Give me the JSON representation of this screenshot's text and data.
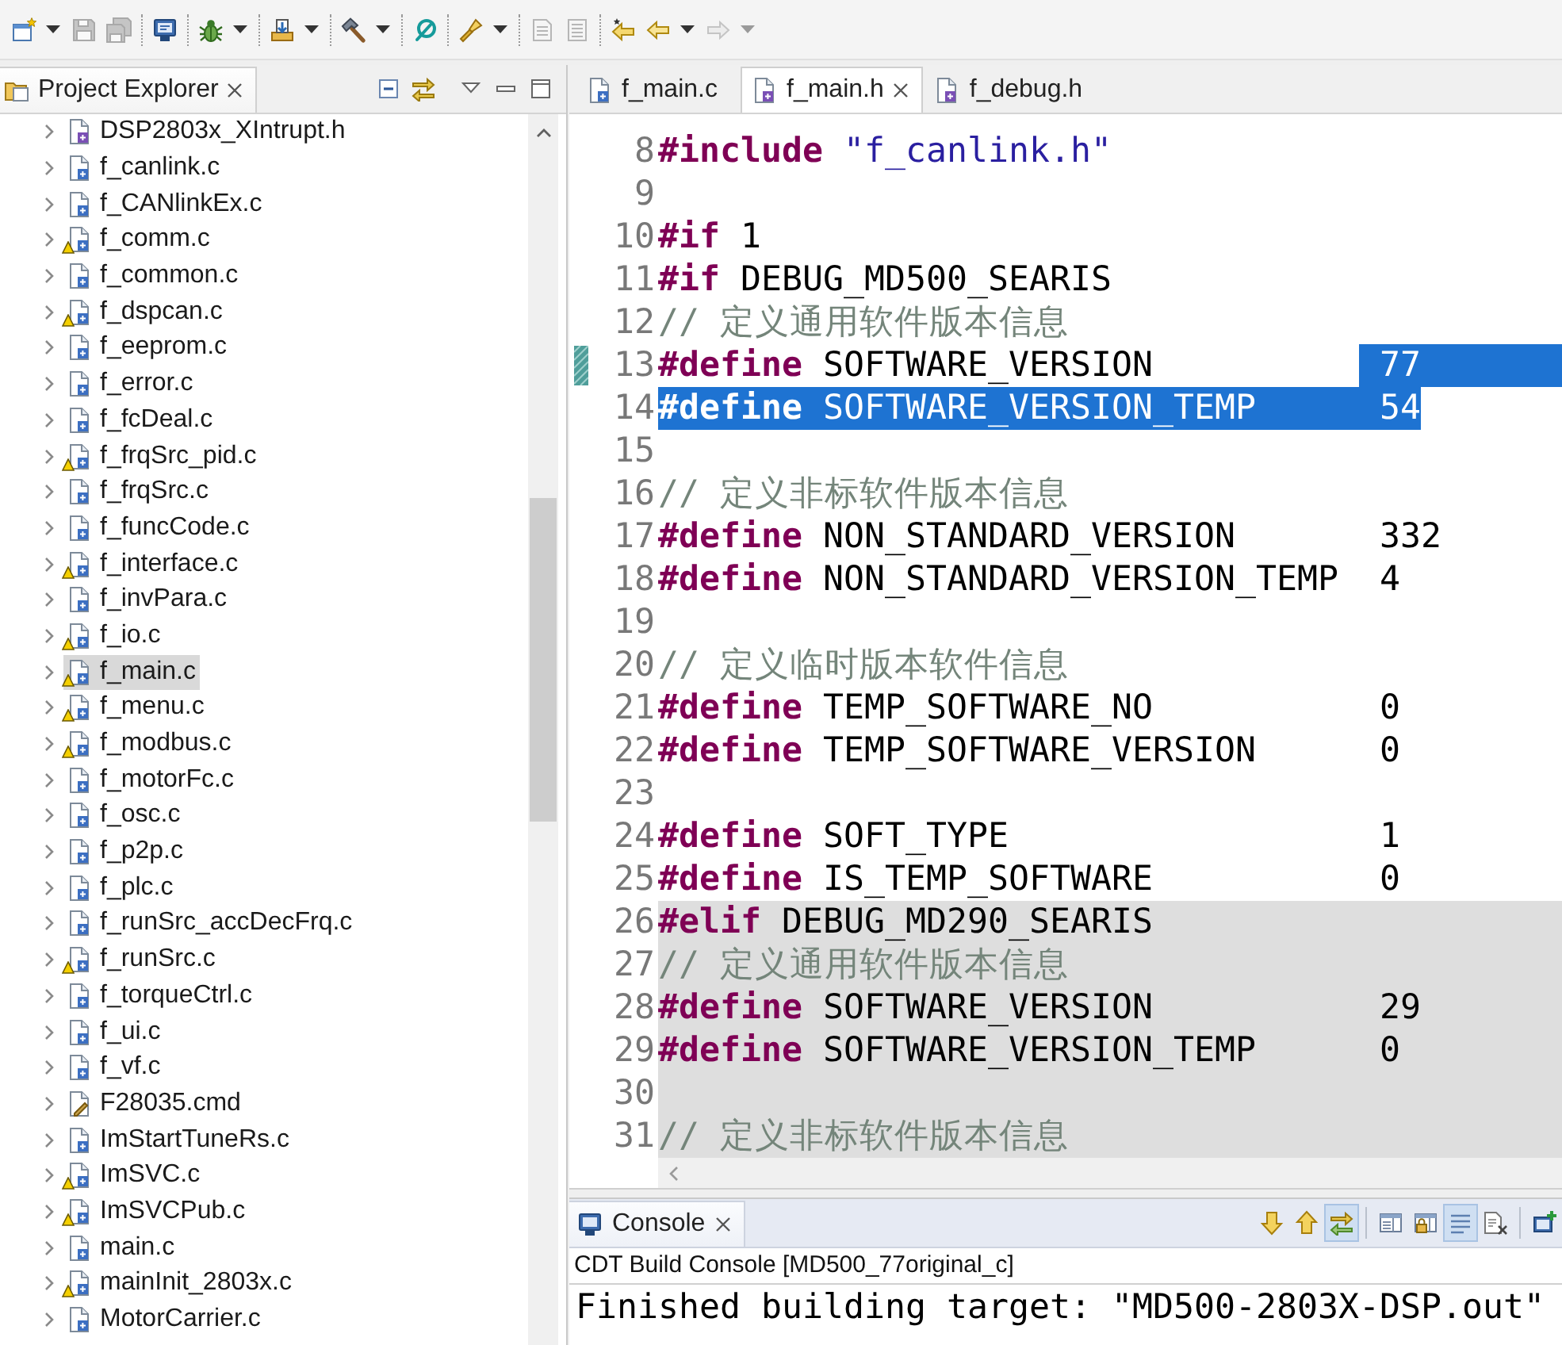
{
  "toolbar": {
    "buttons": [
      {
        "kind": "new",
        "disabled": false,
        "dropdown": true,
        "separator_after": false
      },
      {
        "kind": "save",
        "disabled": true,
        "dropdown": false,
        "separator_after": false
      },
      {
        "kind": "save_all",
        "disabled": true,
        "dropdown": false,
        "separator_after": true
      },
      {
        "kind": "terminal",
        "disabled": false,
        "dropdown": false,
        "separator_after": true
      },
      {
        "kind": "debug",
        "disabled": false,
        "dropdown": true,
        "separator_after": true
      },
      {
        "kind": "load",
        "disabled": false,
        "dropdown": true,
        "separator_after": true
      },
      {
        "kind": "build",
        "disabled": false,
        "dropdown": true,
        "separator_after": true
      },
      {
        "kind": "search",
        "disabled": false,
        "dropdown": false,
        "separator_after": true
      },
      {
        "kind": "tool",
        "disabled": false,
        "dropdown": true,
        "separator_after": true
      },
      {
        "kind": "document",
        "disabled": true,
        "dropdown": false,
        "separator_after": false
      },
      {
        "kind": "outline",
        "disabled": true,
        "dropdown": false,
        "separator_after": true
      },
      {
        "kind": "last_edit",
        "disabled": false,
        "dropdown": false,
        "separator_after": false
      },
      {
        "kind": "back",
        "disabled": false,
        "dropdown": true,
        "separator_after": false
      },
      {
        "kind": "forward",
        "disabled": true,
        "dropdown": true,
        "separator_after": false
      }
    ]
  },
  "explorer": {
    "title": "Project Explorer",
    "items": [
      {
        "label": "DSP2803x_XIntrupt.h",
        "kind": "h",
        "warning": false,
        "selected": false,
        "expanded": false
      },
      {
        "label": "f_canlink.c",
        "kind": "c",
        "warning": false,
        "selected": false,
        "expanded": false
      },
      {
        "label": "f_CANlinkEx.c",
        "kind": "c",
        "warning": false,
        "selected": false,
        "expanded": false
      },
      {
        "label": "f_comm.c",
        "kind": "c",
        "warning": true,
        "selected": false,
        "expanded": false
      },
      {
        "label": "f_common.c",
        "kind": "c",
        "warning": false,
        "selected": false,
        "expanded": false
      },
      {
        "label": "f_dspcan.c",
        "kind": "c",
        "warning": true,
        "selected": false,
        "expanded": false
      },
      {
        "label": "f_eeprom.c",
        "kind": "c",
        "warning": false,
        "selected": false,
        "expanded": false
      },
      {
        "label": "f_error.c",
        "kind": "c",
        "warning": false,
        "selected": false,
        "expanded": false
      },
      {
        "label": "f_fcDeal.c",
        "kind": "c",
        "warning": false,
        "selected": false,
        "expanded": false
      },
      {
        "label": "f_frqSrc_pid.c",
        "kind": "c",
        "warning": true,
        "selected": false,
        "expanded": false
      },
      {
        "label": "f_frqSrc.c",
        "kind": "c",
        "warning": false,
        "selected": false,
        "expanded": false
      },
      {
        "label": "f_funcCode.c",
        "kind": "c",
        "warning": false,
        "selected": false,
        "expanded": false
      },
      {
        "label": "f_interface.c",
        "kind": "c",
        "warning": true,
        "selected": false,
        "expanded": false
      },
      {
        "label": "f_invPara.c",
        "kind": "c",
        "warning": false,
        "selected": false,
        "expanded": false
      },
      {
        "label": "f_io.c",
        "kind": "c",
        "warning": true,
        "selected": false,
        "expanded": false
      },
      {
        "label": "f_main.c",
        "kind": "c",
        "warning": true,
        "selected": true,
        "expanded": false
      },
      {
        "label": "f_menu.c",
        "kind": "c",
        "warning": true,
        "selected": false,
        "expanded": false
      },
      {
        "label": "f_modbus.c",
        "kind": "c",
        "warning": true,
        "selected": false,
        "expanded": false
      },
      {
        "label": "f_motorFc.c",
        "kind": "c",
        "warning": false,
        "selected": false,
        "expanded": false
      },
      {
        "label": "f_osc.c",
        "kind": "c",
        "warning": false,
        "selected": false,
        "expanded": false
      },
      {
        "label": "f_p2p.c",
        "kind": "c",
        "warning": false,
        "selected": false,
        "expanded": false
      },
      {
        "label": "f_plc.c",
        "kind": "c",
        "warning": false,
        "selected": false,
        "expanded": false
      },
      {
        "label": "f_runSrc_accDecFrq.c",
        "kind": "c",
        "warning": false,
        "selected": false,
        "expanded": false
      },
      {
        "label": "f_runSrc.c",
        "kind": "c",
        "warning": true,
        "selected": false,
        "expanded": false
      },
      {
        "label": "f_torqueCtrl.c",
        "kind": "c",
        "warning": false,
        "selected": false,
        "expanded": false
      },
      {
        "label": "f_ui.c",
        "kind": "c",
        "warning": false,
        "selected": false,
        "expanded": false
      },
      {
        "label": "f_vf.c",
        "kind": "c",
        "warning": false,
        "selected": false,
        "expanded": false
      },
      {
        "label": "F28035.cmd",
        "kind": "cmd",
        "warning": false,
        "selected": false,
        "expanded": false
      },
      {
        "label": "ImStartTuneRs.c",
        "kind": "c",
        "warning": false,
        "selected": false,
        "expanded": false
      },
      {
        "label": "ImSVC.c",
        "kind": "c",
        "warning": true,
        "selected": false,
        "expanded": false
      },
      {
        "label": "ImSVCPub.c",
        "kind": "c",
        "warning": true,
        "selected": false,
        "expanded": false
      },
      {
        "label": "main.c",
        "kind": "c",
        "warning": false,
        "selected": false,
        "expanded": false
      },
      {
        "label": "mainInit_2803x.c",
        "kind": "c",
        "warning": true,
        "selected": false,
        "expanded": false
      },
      {
        "label": "MotorCarrier.c",
        "kind": "c",
        "warning": false,
        "selected": false,
        "expanded": false
      }
    ]
  },
  "editor": {
    "tabs": [
      {
        "label": "f_main.c",
        "kind": "c",
        "selected": false
      },
      {
        "label": "f_main.h",
        "kind": "h",
        "selected": true
      },
      {
        "label": "f_debug.h",
        "kind": "h",
        "selected": false
      }
    ],
    "lines": [
      {
        "number": "8",
        "kind": "include",
        "directive": "#include",
        "argument": "\"f_canlink.h\"",
        "selected": false,
        "inactive": false,
        "marked": false
      },
      {
        "number": "9",
        "kind": "blank",
        "selected": false,
        "inactive": false,
        "marked": false
      },
      {
        "number": "10",
        "kind": "directive",
        "directive": "#if",
        "argument": "1",
        "selected": false,
        "inactive": false,
        "marked": false
      },
      {
        "number": "11",
        "kind": "directive",
        "directive": "#if",
        "argument": "DEBUG_MD500_SEARIS",
        "selected": false,
        "inactive": false,
        "marked": false
      },
      {
        "number": "12",
        "kind": "comment",
        "text": "// 定义通用软件版本信息",
        "selected": false,
        "inactive": false,
        "marked": false
      },
      {
        "number": "13",
        "kind": "define",
        "directive": "#define",
        "name": "SOFTWARE_VERSION",
        "value": "77",
        "selected": false,
        "value_selected": true,
        "inactive": false,
        "marked": true
      },
      {
        "number": "14",
        "kind": "define",
        "directive": "#define",
        "name": "SOFTWARE_VERSION_TEMP",
        "value": "54",
        "selected": true,
        "value_selected": false,
        "inactive": false,
        "marked": false
      },
      {
        "number": "15",
        "kind": "blank",
        "selected": false,
        "inactive": false,
        "marked": false
      },
      {
        "number": "16",
        "kind": "comment",
        "text": "// 定义非标软件版本信息",
        "selected": false,
        "inactive": false,
        "marked": false
      },
      {
        "number": "17",
        "kind": "define",
        "directive": "#define",
        "name": "NON_STANDARD_VERSION",
        "value": "332",
        "selected": false,
        "value_selected": false,
        "inactive": false,
        "marked": false
      },
      {
        "number": "18",
        "kind": "define",
        "directive": "#define",
        "name": "NON_STANDARD_VERSION_TEMP",
        "value": "4",
        "selected": false,
        "value_selected": false,
        "inactive": false,
        "marked": false
      },
      {
        "number": "19",
        "kind": "blank",
        "selected": false,
        "inactive": false,
        "marked": false
      },
      {
        "number": "20",
        "kind": "comment",
        "text": "// 定义临时版本软件信息",
        "selected": false,
        "inactive": false,
        "marked": false
      },
      {
        "number": "21",
        "kind": "define",
        "directive": "#define",
        "name": "TEMP_SOFTWARE_NO",
        "value": "0",
        "selected": false,
        "value_selected": false,
        "inactive": false,
        "marked": false
      },
      {
        "number": "22",
        "kind": "define",
        "directive": "#define",
        "name": "TEMP_SOFTWARE_VERSION",
        "value": "0",
        "selected": false,
        "value_selected": false,
        "inactive": false,
        "marked": false
      },
      {
        "number": "23",
        "kind": "blank",
        "selected": false,
        "inactive": false,
        "marked": false
      },
      {
        "number": "24",
        "kind": "define",
        "directive": "#define",
        "name": "SOFT_TYPE",
        "value": "1",
        "selected": false,
        "value_selected": false,
        "inactive": false,
        "marked": false
      },
      {
        "number": "25",
        "kind": "define",
        "directive": "#define",
        "name": "IS_TEMP_SOFTWARE",
        "value": "0",
        "selected": false,
        "value_selected": false,
        "inactive": false,
        "marked": false
      },
      {
        "number": "26",
        "kind": "directive",
        "directive": "#elif",
        "argument": "DEBUG_MD290_SEARIS",
        "selected": false,
        "inactive": true,
        "marked": false
      },
      {
        "number": "27",
        "kind": "comment",
        "text": "// 定义通用软件版本信息",
        "selected": false,
        "inactive": true,
        "marked": false
      },
      {
        "number": "28",
        "kind": "define",
        "directive": "#define",
        "name": "SOFTWARE_VERSION",
        "value": "29",
        "selected": false,
        "value_selected": false,
        "inactive": true,
        "marked": false
      },
      {
        "number": "29",
        "kind": "define",
        "directive": "#define",
        "name": "SOFTWARE_VERSION_TEMP",
        "value": "0",
        "selected": false,
        "value_selected": false,
        "inactive": true,
        "marked": false
      },
      {
        "number": "30",
        "kind": "blank",
        "selected": false,
        "inactive": true,
        "marked": false
      },
      {
        "number": "31",
        "kind": "comment",
        "text": "// 定义非标软件版本信息",
        "selected": false,
        "inactive": true,
        "marked": false
      }
    ]
  },
  "console": {
    "tabs": [
      {
        "label": "Console",
        "selected": true
      }
    ],
    "toolbar": [
      {
        "kind": "scroll_down",
        "pressed": false,
        "separator_after": false
      },
      {
        "kind": "scroll_up",
        "pressed": false,
        "separator_after": false
      },
      {
        "kind": "link",
        "pressed": true,
        "separator_after": true
      },
      {
        "kind": "panel",
        "pressed": false,
        "separator_after": false
      },
      {
        "kind": "lock_panel",
        "pressed": false,
        "separator_after": false
      },
      {
        "kind": "wrap",
        "pressed": true,
        "separator_after": false
      },
      {
        "kind": "clear",
        "pressed": false,
        "separator_after": true
      },
      {
        "kind": "new_console",
        "pressed": false,
        "separator_after": false
      }
    ],
    "title": "CDT Build Console [MD500_77original_c]",
    "output": [
      "Finished building target: \"MD500-2803X-DSP.out\""
    ]
  }
}
